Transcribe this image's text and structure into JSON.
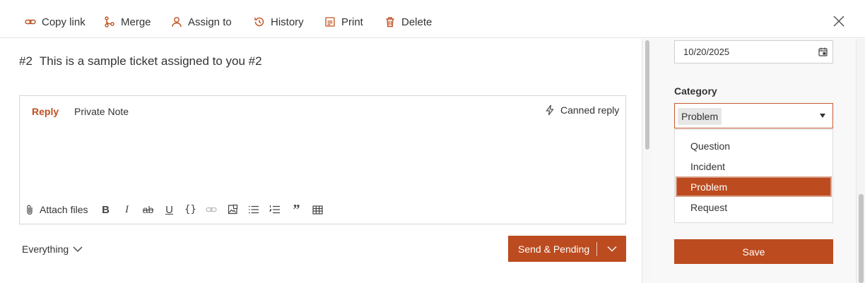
{
  "toolbar": {
    "copy_link": "Copy link",
    "merge": "Merge",
    "assign_to": "Assign to",
    "history": "History",
    "print": "Print",
    "delete": "Delete"
  },
  "ticket": {
    "number": "#2",
    "subject": "This is a sample ticket assigned to you #2"
  },
  "editor": {
    "tabs": {
      "reply": "Reply",
      "private_note": "Private Note"
    },
    "canned_reply": "Canned reply",
    "attach_files": "Attach files",
    "format": {
      "bold": "B",
      "italic": "I",
      "strike": "ab",
      "underline": "U",
      "code": "{}",
      "quote": "”"
    }
  },
  "footer": {
    "filter": "Everything",
    "send": "Send & Pending"
  },
  "sidebar": {
    "date_value": "10/20/2025",
    "category_label": "Category",
    "category_selected": "Problem",
    "category_options": [
      "Question",
      "Incident",
      "Problem",
      "Request"
    ],
    "save": "Save"
  },
  "colors": {
    "accent": "#bc4b1f"
  }
}
